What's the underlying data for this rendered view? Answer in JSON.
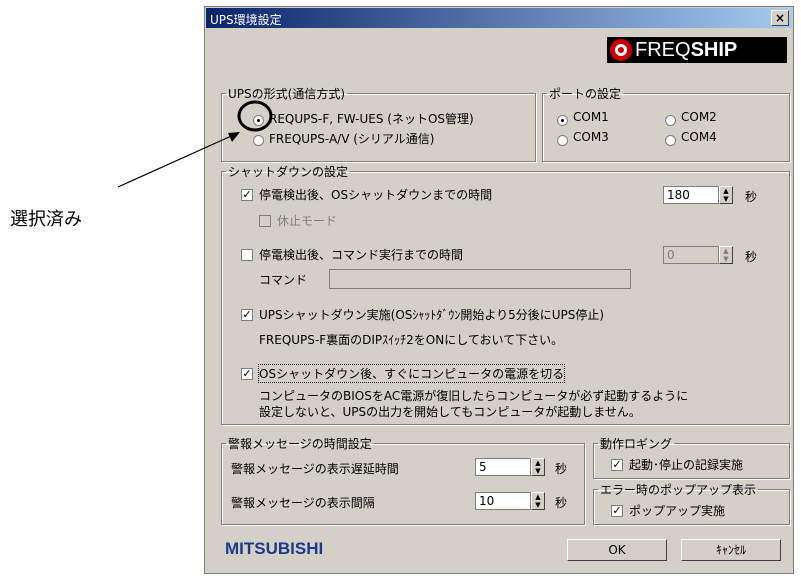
{
  "annotation": {
    "label": "選択済み"
  },
  "dialog": {
    "title": "UPS環境設定",
    "close": "×",
    "logo_text_freq": "FREQ",
    "logo_text_ship": "SHIP",
    "brand": "MITSUBISHI",
    "ok": "OK",
    "cancel": "ｷｬﾝｾﾙ"
  },
  "ups_type": {
    "legend": "UPSの形式(通信方式)",
    "option1": "REQUPS-F, FW-UES (ネットOS管理)",
    "option2": "FREQUPS-A/V (シリアル通信)",
    "selected": 1
  },
  "port": {
    "legend": "ポートの設定",
    "com1": "COM1",
    "com2": "COM2",
    "com3": "COM3",
    "com4": "COM4",
    "selected": "COM1"
  },
  "shutdown": {
    "legend": "シャットダウンの設定",
    "os_shutdown_label": "停電検出後、OSシャットダウンまでの時間",
    "os_shutdown_value": "180",
    "os_shutdown_checked": true,
    "hibernate_label": "休止モード",
    "cmd_exec_label": "停電検出後、コマンド実行までの時間",
    "cmd_exec_value": "0",
    "command_label": "コマンド",
    "command_value": "",
    "ups_shutdown_label": "UPSシャットダウン実施(OSｼｬｯﾄﾀﾞｳﾝ開始より5分後にUPS停止)",
    "ups_shutdown_note": "FREQUPS-F裏面のDIPｽｲｯﾁ2をONにしておいて下さい。",
    "power_off_label": "OSシャットダウン後、すぐにコンピュータの電源を切る",
    "power_off_note1": "コンピュータのBIOSをAC電源が復旧したらコンピュータが必ず起動するように",
    "power_off_note2": "設定しないと、UPSの出力を開始してもコンピュータが起動しません。",
    "unit": "秒"
  },
  "alert": {
    "legend": "警報メッセージの時間設定",
    "delay_label": "警報メッセージの表示遅延時間",
    "delay_value": "5",
    "interval_label": "警報メッセージの表示間隔",
    "interval_value": "10",
    "unit": "秒"
  },
  "logging": {
    "legend": "動作ロギング",
    "label": "起動･停止の記録実施"
  },
  "popup": {
    "legend": "エラー時のポップアップ表示",
    "label": "ポップアップ実施"
  },
  "colors": {
    "titlebar": "#0a246a",
    "logo_red": "#cc0000",
    "dialog_bg": "#d4d0c8"
  },
  "icons": {
    "logo": "freqship-logo-icon",
    "arrow": "annotation-arrow-icon",
    "circle": "annotation-circle-icon"
  }
}
